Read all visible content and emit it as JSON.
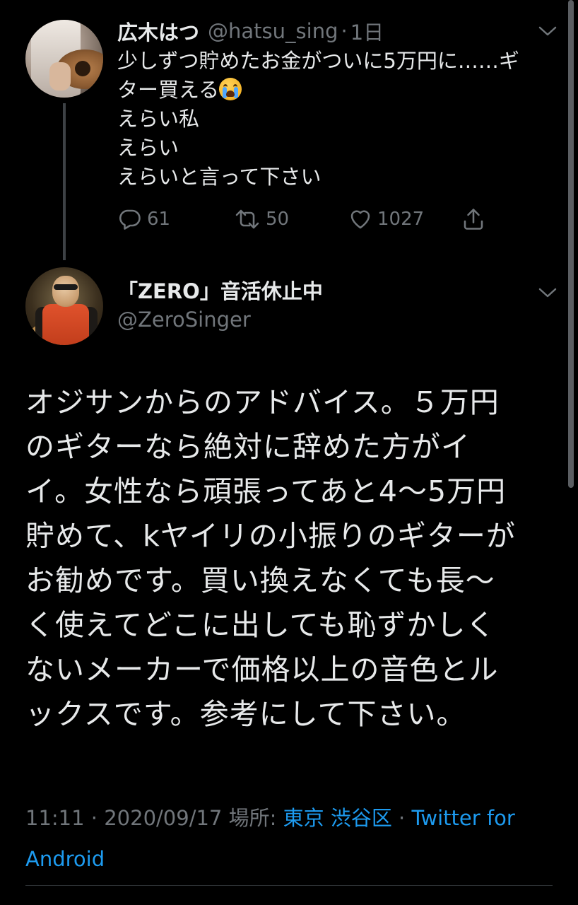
{
  "parent_tweet": {
    "display_name": "広木はつ",
    "handle": "@hatsu_sing",
    "separator": "·",
    "time_ago": "1日",
    "text_lines": [
      "少しずつ貯めたお金がついに5万円に……ギ",
      "ター買える",
      "えらい私",
      "えらい",
      "えらいと言って下さい"
    ],
    "emoji": "loudly-crying-face",
    "reply_count": "61",
    "retweet_count": "50",
    "like_count": "1027"
  },
  "main_tweet": {
    "display_name": "「ZERO」音活休止中",
    "handle": "@ZeroSinger",
    "text_lines": [
      "オジサンからのアドバイス。５万円",
      "のギターなら絶対に辞めた方がイ",
      "イ。女性なら頑張ってあと4〜5万円",
      "貯めて、kヤイリの小振りのギターが",
      "お勧めです。買い換えなくても長〜",
      "く使えてどこに出しても恥ずかしく",
      "ないメーカーで価格以上の音色とル",
      "ックスです。参考にして下さい。"
    ],
    "meta": {
      "time": "11:11",
      "separator": "·",
      "date": "2020/09/17",
      "location_label": "場所:",
      "location": "東京 渋谷区",
      "separator2": "·",
      "source_line1": "Twitter for",
      "source_line2": "Android"
    }
  },
  "colors": {
    "background": "#000000",
    "text": "#e7e9ea",
    "secondary": "#71767b",
    "link": "#1d9bf0",
    "divider": "#2f3336"
  },
  "icons": [
    "chevron-down-icon",
    "reply-icon",
    "retweet-icon",
    "like-icon",
    "share-icon"
  ]
}
